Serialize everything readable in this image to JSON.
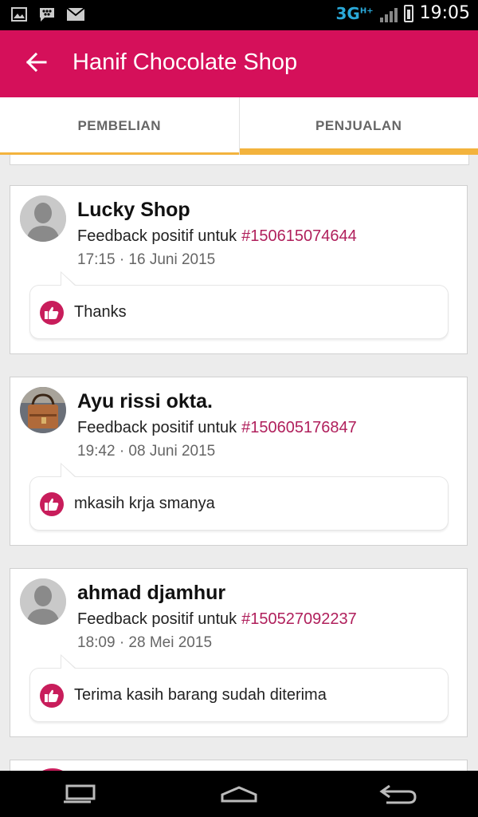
{
  "status_bar": {
    "network": "3G",
    "network_sup": "H+",
    "time": "19:05",
    "icons": [
      "image-icon",
      "bbm-icon",
      "mail-icon",
      "signal-icon",
      "battery-icon"
    ]
  },
  "app_bar": {
    "title": "Hanif Chocolate Shop",
    "back_icon": "arrow-back-icon",
    "color": "#d5105a"
  },
  "tabs": [
    {
      "label": "PEMBELIAN",
      "active": false
    },
    {
      "label": "PENJUALAN",
      "active": true
    }
  ],
  "accent_color": "#f3b33d",
  "feedback_items": [
    {
      "name": "Lucky Shop",
      "feedback_text": "Feedback positif untuk",
      "order_id": "#150615074644",
      "time": "17:15 · 16 Juni 2015",
      "comment": "Thanks",
      "avatar": "default"
    },
    {
      "name": "Ayu rissi okta.",
      "feedback_text": "Feedback positif untuk",
      "order_id": "#150605176847",
      "time": "19:42 · 08 Juni 2015",
      "comment": "mkasih krja smanya",
      "avatar": "bag-photo"
    },
    {
      "name": "ahmad djamhur",
      "feedback_text": "Feedback positif untuk",
      "order_id": "#150527092237",
      "time": "18:09 · 28 Mei 2015",
      "comment": "Terima kasih barang sudah diterima",
      "avatar": "default"
    }
  ],
  "nav_bar": {
    "icons": [
      "recent-apps-icon",
      "home-icon",
      "back-icon"
    ]
  }
}
